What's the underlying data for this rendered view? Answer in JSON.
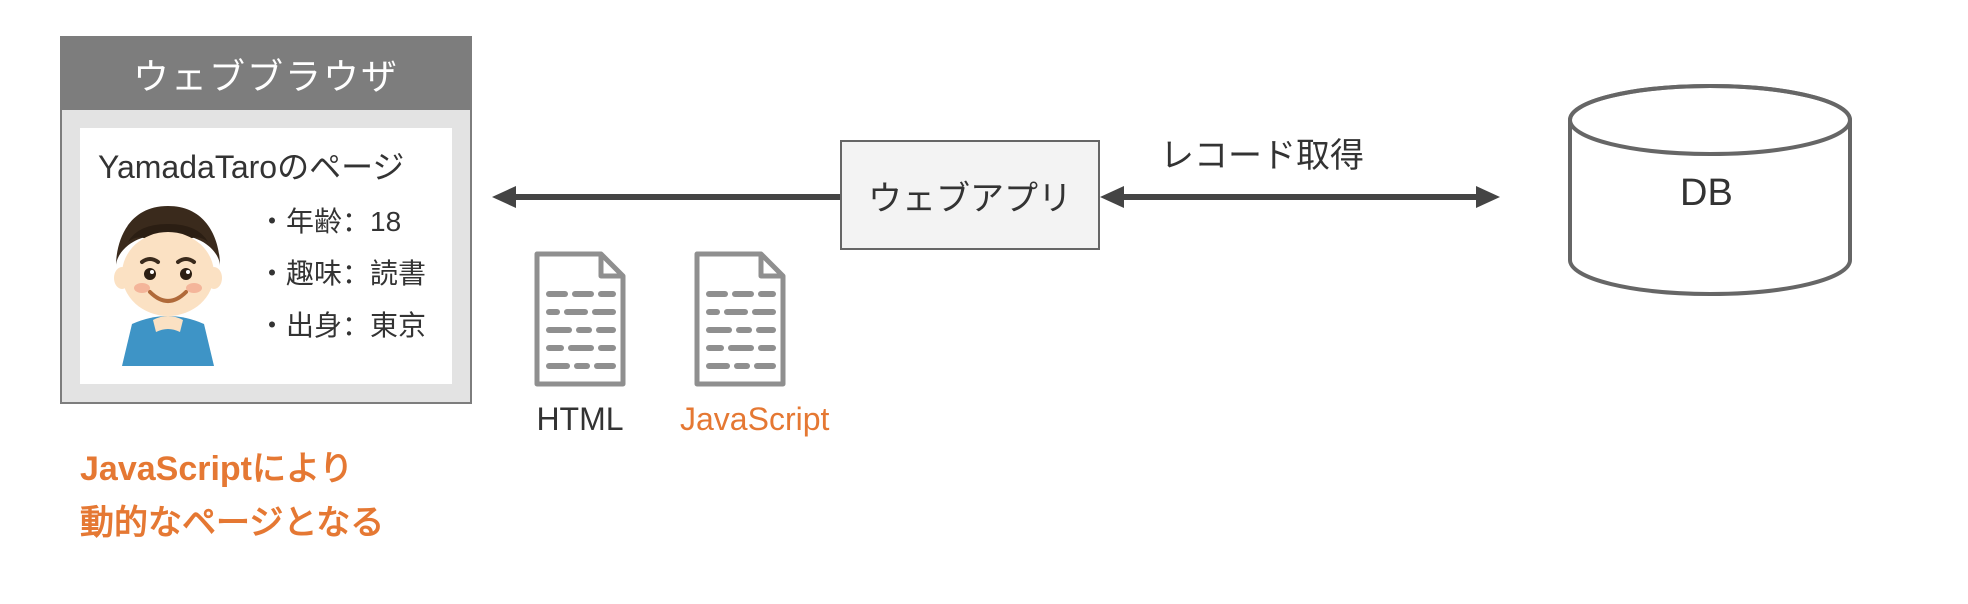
{
  "browser": {
    "title": "ウェブブラウザ",
    "page_title": "YamadaTaroのページ",
    "profile": {
      "age_label": "・年齢：",
      "age_value": "18",
      "hobby_label": "・趣味：",
      "hobby_value": "読書",
      "origin_label": "・出身：",
      "origin_value": "東京"
    }
  },
  "caption": {
    "line1": "JavaScriptにより",
    "line2": "動的なページとなる"
  },
  "webapp": {
    "label": "ウェブアプリ"
  },
  "db": {
    "label": "DB",
    "arrow_label": "レコード取得"
  },
  "files": {
    "html_label": "HTML",
    "js_label": "JavaScript"
  },
  "icons": {
    "avatar": "boy-avatar",
    "file": "document-icon",
    "db": "database-cylinder-icon",
    "arrow_left": "arrow-left-icon",
    "arrow_bidir": "arrow-bidirectional-icon"
  },
  "colors": {
    "accent": "#e57833",
    "gray": "#7d7d7d"
  }
}
